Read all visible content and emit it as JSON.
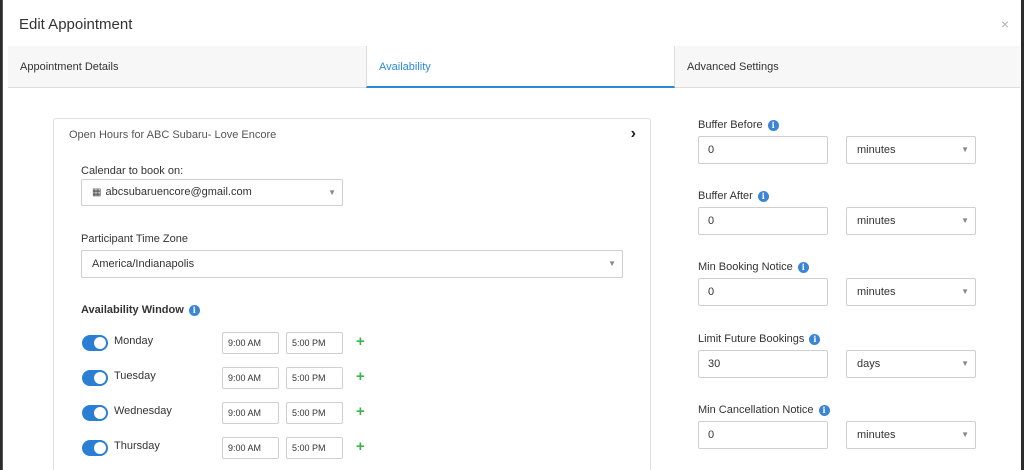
{
  "dialog": {
    "title": "Edit Appointment",
    "close_icon": "×"
  },
  "tabs": [
    {
      "label": "Appointment Details",
      "active": false
    },
    {
      "label": "Availability",
      "active": true
    },
    {
      "label": "Advanced Settings",
      "active": false
    }
  ],
  "open_hours": {
    "title": "Open Hours for ABC Subaru- Love Encore",
    "chevron": "›"
  },
  "calendar": {
    "label": "Calendar to book on:",
    "value": "abcsubaruencore@gmail.com"
  },
  "timezone": {
    "label": "Participant Time Zone",
    "value": "America/Indianapolis"
  },
  "availability": {
    "label": "Availability Window",
    "days": [
      {
        "name": "Monday",
        "enabled": true,
        "start": "9:00 AM",
        "end": "5:00 PM"
      },
      {
        "name": "Tuesday",
        "enabled": true,
        "start": "9:00 AM",
        "end": "5:00 PM"
      },
      {
        "name": "Wednesday",
        "enabled": true,
        "start": "9:00 AM",
        "end": "5:00 PM"
      },
      {
        "name": "Thursday",
        "enabled": true,
        "start": "9:00 AM",
        "end": "5:00 PM"
      }
    ],
    "add_icon": "+"
  },
  "settings": [
    {
      "label": "Buffer Before",
      "value": "0",
      "unit": "minutes"
    },
    {
      "label": "Buffer After",
      "value": "0",
      "unit": "minutes"
    },
    {
      "label": "Min Booking Notice",
      "value": "0",
      "unit": "minutes"
    },
    {
      "label": "Limit Future Bookings",
      "value": "30",
      "unit": "days"
    },
    {
      "label": "Min Cancellation Notice",
      "value": "0",
      "unit": "minutes"
    }
  ],
  "colors": {
    "accent": "#2a8ad8",
    "toggle_on": "#2a7fd4",
    "add_green": "#3cb44b",
    "info_blue": "#3b85d6"
  }
}
